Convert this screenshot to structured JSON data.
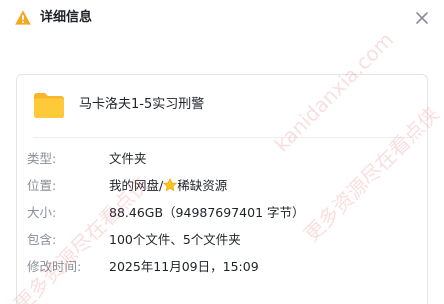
{
  "header": {
    "title": "详细信息",
    "icon": "info-icon",
    "close_icon": "close-icon"
  },
  "file": {
    "name": "马卡洛夫1-5实习刑警",
    "icon": "folder-icon"
  },
  "properties": {
    "type": {
      "label": "类型:",
      "value": "文件夹"
    },
    "location": {
      "label": "位置:",
      "value_prefix": "我的网盘/",
      "value_suffix": "稀缺资源"
    },
    "size": {
      "label": "大小:",
      "value": "88.46GB（94987697401 字节）"
    },
    "contains": {
      "label": "包含:",
      "value": "100个文件、5个文件夹"
    },
    "modified": {
      "label": "修改时间:",
      "value": "2025年11月09日，15:09"
    }
  },
  "watermark": {
    "text_a": "kanidanxia.com",
    "text_b": "更多资源尽在看点侠",
    "text_c": "更多资源尽在看点侠"
  },
  "colors": {
    "accent": "#f4b400",
    "folder": "#ffc833",
    "watermark": "#e26e6e"
  }
}
